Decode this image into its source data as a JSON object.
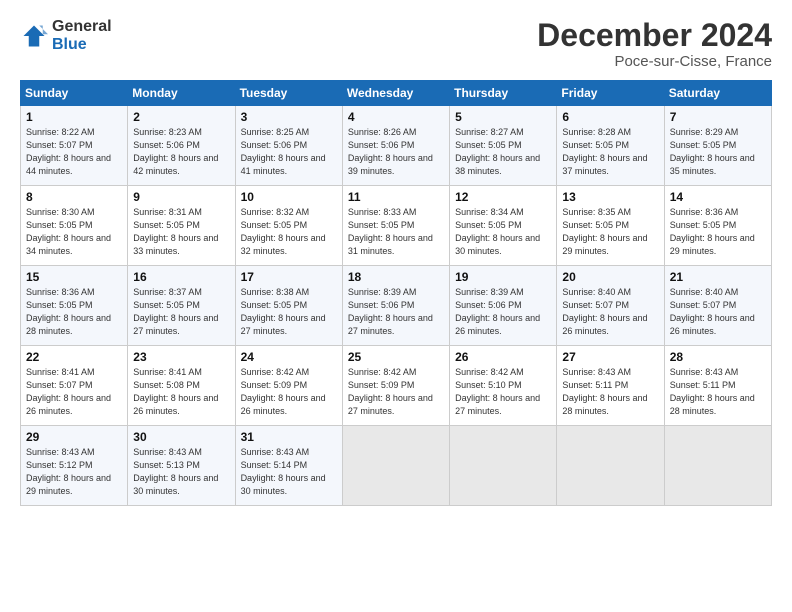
{
  "header": {
    "logo_general": "General",
    "logo_blue": "Blue",
    "title": "December 2024",
    "subtitle": "Poce-sur-Cisse, France"
  },
  "weekdays": [
    "Sunday",
    "Monday",
    "Tuesday",
    "Wednesday",
    "Thursday",
    "Friday",
    "Saturday"
  ],
  "weeks": [
    [
      {
        "day": "1",
        "sunrise": "Sunrise: 8:22 AM",
        "sunset": "Sunset: 5:07 PM",
        "daylight": "Daylight: 8 hours and 44 minutes."
      },
      {
        "day": "2",
        "sunrise": "Sunrise: 8:23 AM",
        "sunset": "Sunset: 5:06 PM",
        "daylight": "Daylight: 8 hours and 42 minutes."
      },
      {
        "day": "3",
        "sunrise": "Sunrise: 8:25 AM",
        "sunset": "Sunset: 5:06 PM",
        "daylight": "Daylight: 8 hours and 41 minutes."
      },
      {
        "day": "4",
        "sunrise": "Sunrise: 8:26 AM",
        "sunset": "Sunset: 5:06 PM",
        "daylight": "Daylight: 8 hours and 39 minutes."
      },
      {
        "day": "5",
        "sunrise": "Sunrise: 8:27 AM",
        "sunset": "Sunset: 5:05 PM",
        "daylight": "Daylight: 8 hours and 38 minutes."
      },
      {
        "day": "6",
        "sunrise": "Sunrise: 8:28 AM",
        "sunset": "Sunset: 5:05 PM",
        "daylight": "Daylight: 8 hours and 37 minutes."
      },
      {
        "day": "7",
        "sunrise": "Sunrise: 8:29 AM",
        "sunset": "Sunset: 5:05 PM",
        "daylight": "Daylight: 8 hours and 35 minutes."
      }
    ],
    [
      {
        "day": "8",
        "sunrise": "Sunrise: 8:30 AM",
        "sunset": "Sunset: 5:05 PM",
        "daylight": "Daylight: 8 hours and 34 minutes."
      },
      {
        "day": "9",
        "sunrise": "Sunrise: 8:31 AM",
        "sunset": "Sunset: 5:05 PM",
        "daylight": "Daylight: 8 hours and 33 minutes."
      },
      {
        "day": "10",
        "sunrise": "Sunrise: 8:32 AM",
        "sunset": "Sunset: 5:05 PM",
        "daylight": "Daylight: 8 hours and 32 minutes."
      },
      {
        "day": "11",
        "sunrise": "Sunrise: 8:33 AM",
        "sunset": "Sunset: 5:05 PM",
        "daylight": "Daylight: 8 hours and 31 minutes."
      },
      {
        "day": "12",
        "sunrise": "Sunrise: 8:34 AM",
        "sunset": "Sunset: 5:05 PM",
        "daylight": "Daylight: 8 hours and 30 minutes."
      },
      {
        "day": "13",
        "sunrise": "Sunrise: 8:35 AM",
        "sunset": "Sunset: 5:05 PM",
        "daylight": "Daylight: 8 hours and 29 minutes."
      },
      {
        "day": "14",
        "sunrise": "Sunrise: 8:36 AM",
        "sunset": "Sunset: 5:05 PM",
        "daylight": "Daylight: 8 hours and 29 minutes."
      }
    ],
    [
      {
        "day": "15",
        "sunrise": "Sunrise: 8:36 AM",
        "sunset": "Sunset: 5:05 PM",
        "daylight": "Daylight: 8 hours and 28 minutes."
      },
      {
        "day": "16",
        "sunrise": "Sunrise: 8:37 AM",
        "sunset": "Sunset: 5:05 PM",
        "daylight": "Daylight: 8 hours and 27 minutes."
      },
      {
        "day": "17",
        "sunrise": "Sunrise: 8:38 AM",
        "sunset": "Sunset: 5:05 PM",
        "daylight": "Daylight: 8 hours and 27 minutes."
      },
      {
        "day": "18",
        "sunrise": "Sunrise: 8:39 AM",
        "sunset": "Sunset: 5:06 PM",
        "daylight": "Daylight: 8 hours and 27 minutes."
      },
      {
        "day": "19",
        "sunrise": "Sunrise: 8:39 AM",
        "sunset": "Sunset: 5:06 PM",
        "daylight": "Daylight: 8 hours and 26 minutes."
      },
      {
        "day": "20",
        "sunrise": "Sunrise: 8:40 AM",
        "sunset": "Sunset: 5:07 PM",
        "daylight": "Daylight: 8 hours and 26 minutes."
      },
      {
        "day": "21",
        "sunrise": "Sunrise: 8:40 AM",
        "sunset": "Sunset: 5:07 PM",
        "daylight": "Daylight: 8 hours and 26 minutes."
      }
    ],
    [
      {
        "day": "22",
        "sunrise": "Sunrise: 8:41 AM",
        "sunset": "Sunset: 5:07 PM",
        "daylight": "Daylight: 8 hours and 26 minutes."
      },
      {
        "day": "23",
        "sunrise": "Sunrise: 8:41 AM",
        "sunset": "Sunset: 5:08 PM",
        "daylight": "Daylight: 8 hours and 26 minutes."
      },
      {
        "day": "24",
        "sunrise": "Sunrise: 8:42 AM",
        "sunset": "Sunset: 5:09 PM",
        "daylight": "Daylight: 8 hours and 26 minutes."
      },
      {
        "day": "25",
        "sunrise": "Sunrise: 8:42 AM",
        "sunset": "Sunset: 5:09 PM",
        "daylight": "Daylight: 8 hours and 27 minutes."
      },
      {
        "day": "26",
        "sunrise": "Sunrise: 8:42 AM",
        "sunset": "Sunset: 5:10 PM",
        "daylight": "Daylight: 8 hours and 27 minutes."
      },
      {
        "day": "27",
        "sunrise": "Sunrise: 8:43 AM",
        "sunset": "Sunset: 5:11 PM",
        "daylight": "Daylight: 8 hours and 28 minutes."
      },
      {
        "day": "28",
        "sunrise": "Sunrise: 8:43 AM",
        "sunset": "Sunset: 5:11 PM",
        "daylight": "Daylight: 8 hours and 28 minutes."
      }
    ],
    [
      {
        "day": "29",
        "sunrise": "Sunrise: 8:43 AM",
        "sunset": "Sunset: 5:12 PM",
        "daylight": "Daylight: 8 hours and 29 minutes."
      },
      {
        "day": "30",
        "sunrise": "Sunrise: 8:43 AM",
        "sunset": "Sunset: 5:13 PM",
        "daylight": "Daylight: 8 hours and 30 minutes."
      },
      {
        "day": "31",
        "sunrise": "Sunrise: 8:43 AM",
        "sunset": "Sunset: 5:14 PM",
        "daylight": "Daylight: 8 hours and 30 minutes."
      },
      {
        "day": "",
        "sunrise": "",
        "sunset": "",
        "daylight": ""
      },
      {
        "day": "",
        "sunrise": "",
        "sunset": "",
        "daylight": ""
      },
      {
        "day": "",
        "sunrise": "",
        "sunset": "",
        "daylight": ""
      },
      {
        "day": "",
        "sunrise": "",
        "sunset": "",
        "daylight": ""
      }
    ]
  ]
}
